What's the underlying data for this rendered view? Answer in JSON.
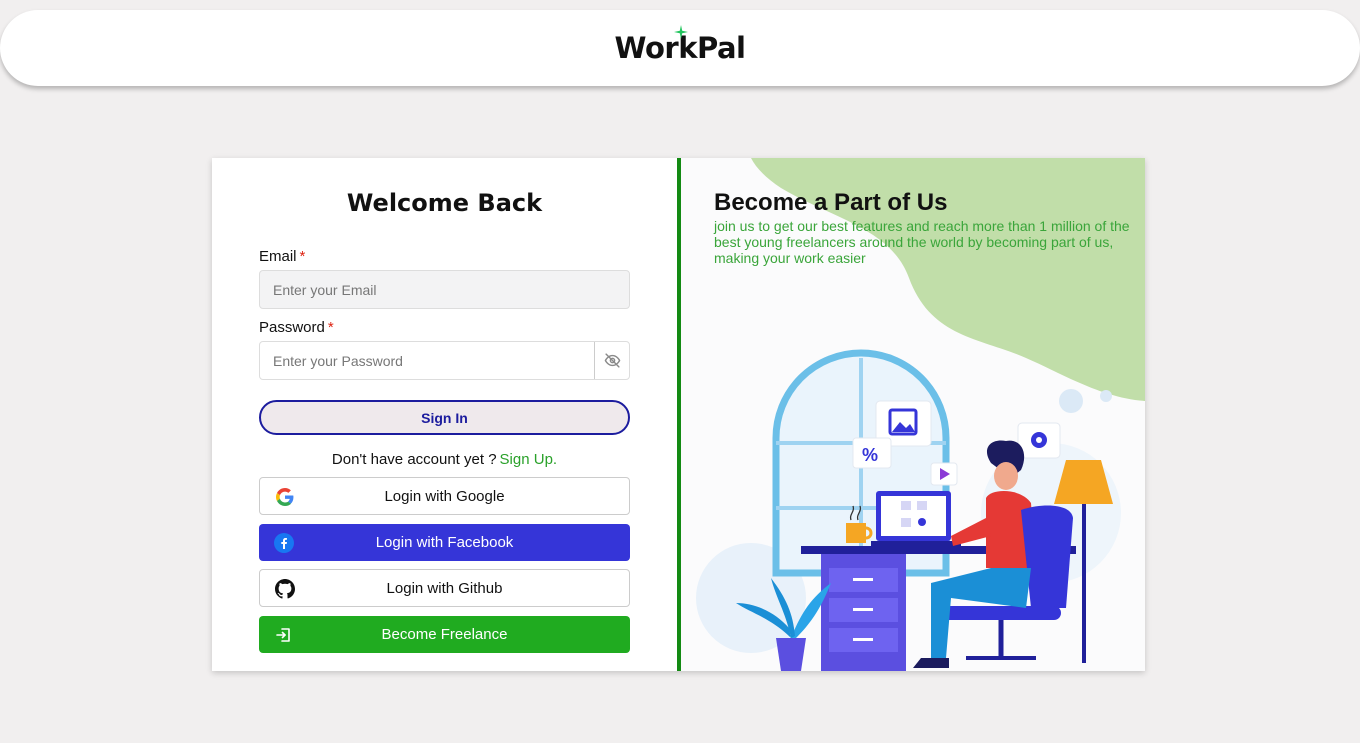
{
  "header": {
    "logo_text": "WorkPal"
  },
  "login": {
    "title": "Welcome Back",
    "email_label": "Email",
    "email_placeholder": "Enter your Email",
    "password_label": "Password",
    "password_placeholder": "Enter your Password",
    "required_mark": "*",
    "signin_label": "Sign In",
    "no_account_text": "Don't have account yet ?",
    "signup_link": "Sign Up.",
    "google_label": "Login with Google",
    "facebook_label": "Login with Facebook",
    "github_label": "Login with Github",
    "freelance_label": "Become Freelance"
  },
  "promo": {
    "title": "Become a Part of Us",
    "subtitle": "join us to get our best features and reach more than 1 million of the best young freelancers around the world by becoming part of us, making your work easier"
  },
  "colors": {
    "accent_green": "#20ab20",
    "divider_green": "#138a13",
    "facebook_blue": "#3535d8",
    "signin_border": "#1c1c9e",
    "blob_green": "#c1dea9"
  },
  "icons": [
    "sparkle-icon",
    "eye-off-icon",
    "google-icon",
    "facebook-icon",
    "github-icon",
    "login-enter-icon"
  ]
}
